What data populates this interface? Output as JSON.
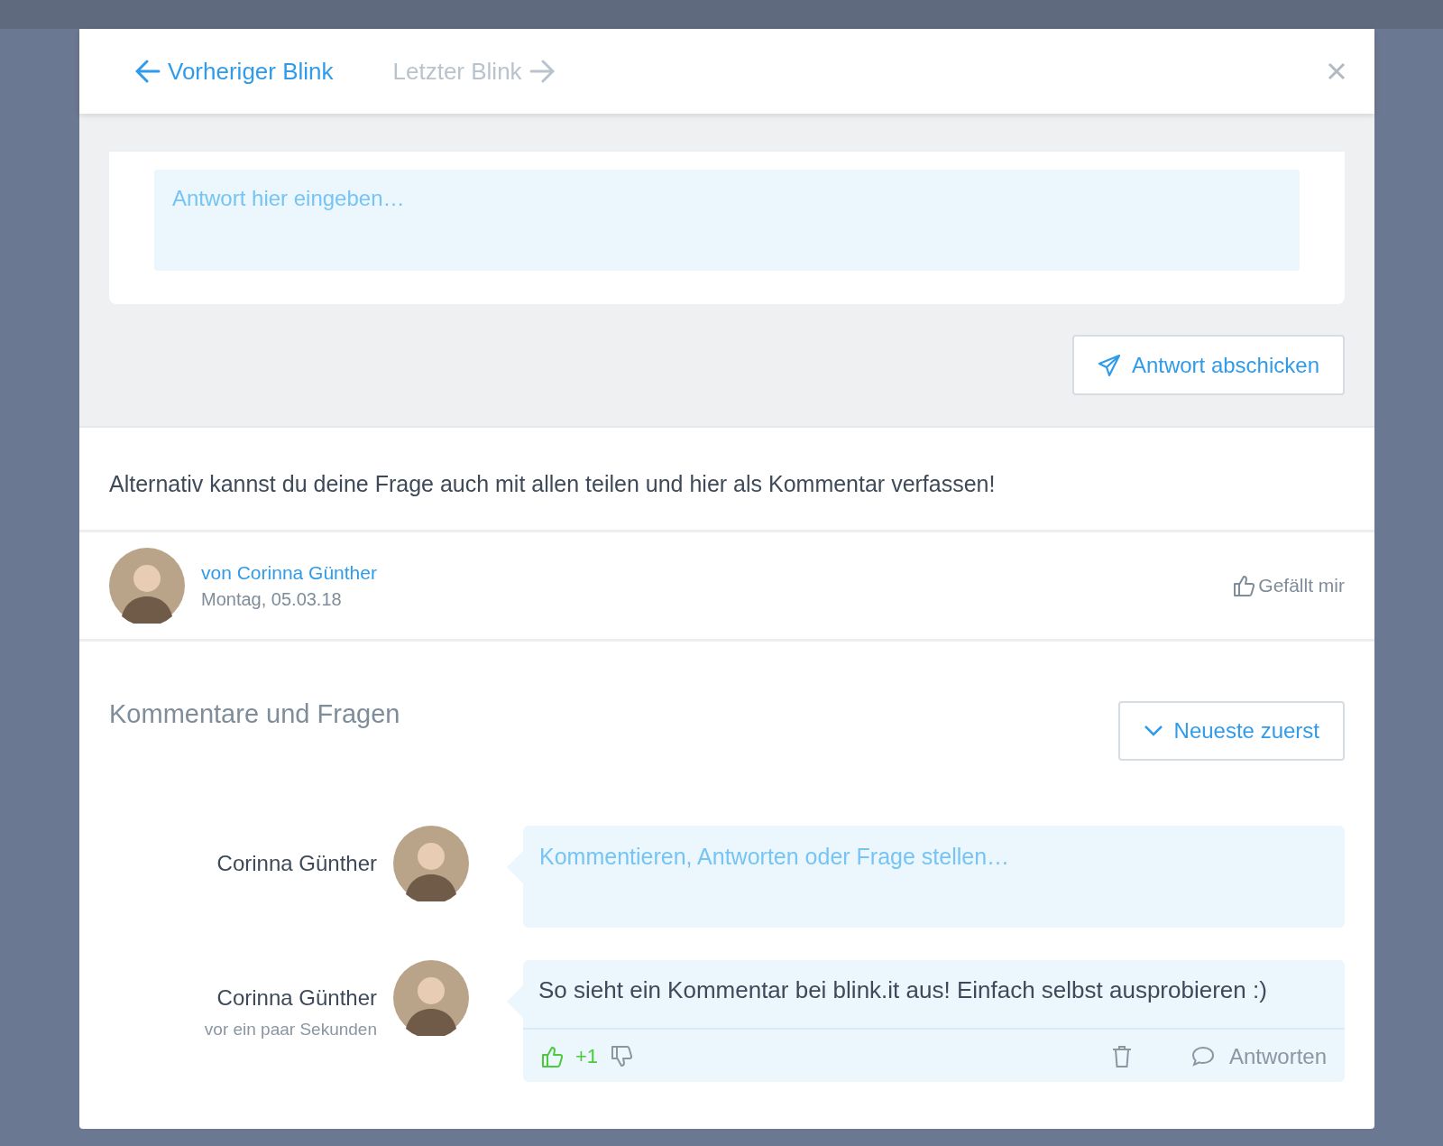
{
  "header": {
    "nav": [
      {
        "label": "Vorheriger Blink",
        "kind": "back",
        "disabled": false
      },
      {
        "label": "Letzter Blink",
        "kind": "forward",
        "disabled": true
      }
    ]
  },
  "answer": {
    "placeholder": "Antwort hier eingeben…",
    "submit": "Antwort abschicken"
  },
  "share_hint": "Alternativ kannst du deine Frage auch mit allen teilen und hier als Kommentar verfassen!",
  "author": {
    "byline": "von Corinna Günther",
    "date": "Montag, 05.03.18",
    "like": "Gefällt mir"
  },
  "comments_section": {
    "title": "Kommentare und Fragen",
    "sort": "Neueste zuerst",
    "composer": {
      "name": "Corinna Günther",
      "placeholder": "Kommentieren, Antworten oder Frage stellen…"
    },
    "comments": [
      {
        "name": "Corinna Günther",
        "time": "vor ein paar Sekunden",
        "text": "So sieht ein Kommentar bei blink.it aus! Einfach selbst ausprobieren :)",
        "liked": true,
        "score": "+1",
        "reply": "Antworten"
      }
    ]
  }
}
